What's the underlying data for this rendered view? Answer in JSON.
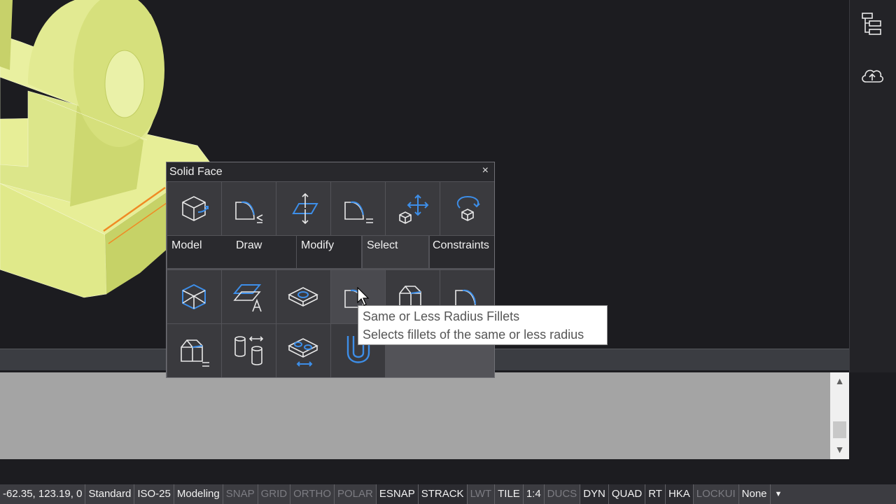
{
  "palette": {
    "title": "Solid Face",
    "close_label": "×",
    "tabs": [
      {
        "label": "Model"
      },
      {
        "label": "Draw"
      },
      {
        "label": "Modify"
      },
      {
        "label": "Select"
      },
      {
        "label": "Constraints"
      }
    ],
    "top_tools": [
      "solid-box-icon",
      "radius-less-fillet-icon",
      "move-face-icon",
      "equal-fillet-icon",
      "move-solid-icon",
      "rotate-solid-icon"
    ],
    "select_tools": [
      "select-all-faces-icon",
      "select-planar-text-icon",
      "select-holes-icon",
      "same-or-less-radius-fillets-icon",
      "less-chamfers-icon",
      "fillets-icon",
      "equal-chamfers-icon",
      "equal-cylinders-icon",
      "equal-holes-icon",
      "u-shape-icon"
    ]
  },
  "tooltip": {
    "title": "Same or Less Radius Fillets",
    "description": "Selects fillets of the same or less radius"
  },
  "right_rail": [
    "hierarchy-tree-icon",
    "cloud-upload-icon"
  ],
  "status_bar": {
    "coordinates": "-62.35, 123.19, 0",
    "items": [
      {
        "label": "Standard",
        "state": "text"
      },
      {
        "label": "ISO-25",
        "state": "text"
      },
      {
        "label": "Modeling",
        "state": "text"
      },
      {
        "label": "SNAP",
        "state": "off"
      },
      {
        "label": "GRID",
        "state": "off"
      },
      {
        "label": "ORTHO",
        "state": "off"
      },
      {
        "label": "POLAR",
        "state": "off"
      },
      {
        "label": "ESNAP",
        "state": "on"
      },
      {
        "label": "STRACK",
        "state": "on"
      },
      {
        "label": "LWT",
        "state": "off"
      },
      {
        "label": "TILE",
        "state": "text"
      },
      {
        "label": "1:4",
        "state": "text"
      },
      {
        "label": "DUCS",
        "state": "off"
      },
      {
        "label": "DYN",
        "state": "on"
      },
      {
        "label": "QUAD",
        "state": "on"
      },
      {
        "label": "RT",
        "state": "on"
      },
      {
        "label": "HKA",
        "state": "on"
      },
      {
        "label": "LOCKUI",
        "state": "off"
      },
      {
        "label": "None",
        "state": "text"
      }
    ],
    "dropdown_icon": "▼"
  },
  "colors": {
    "accent_blue": "#3d8ee8",
    "model_fill": "#e2ec8c",
    "selected_edge": "#f08a24"
  }
}
